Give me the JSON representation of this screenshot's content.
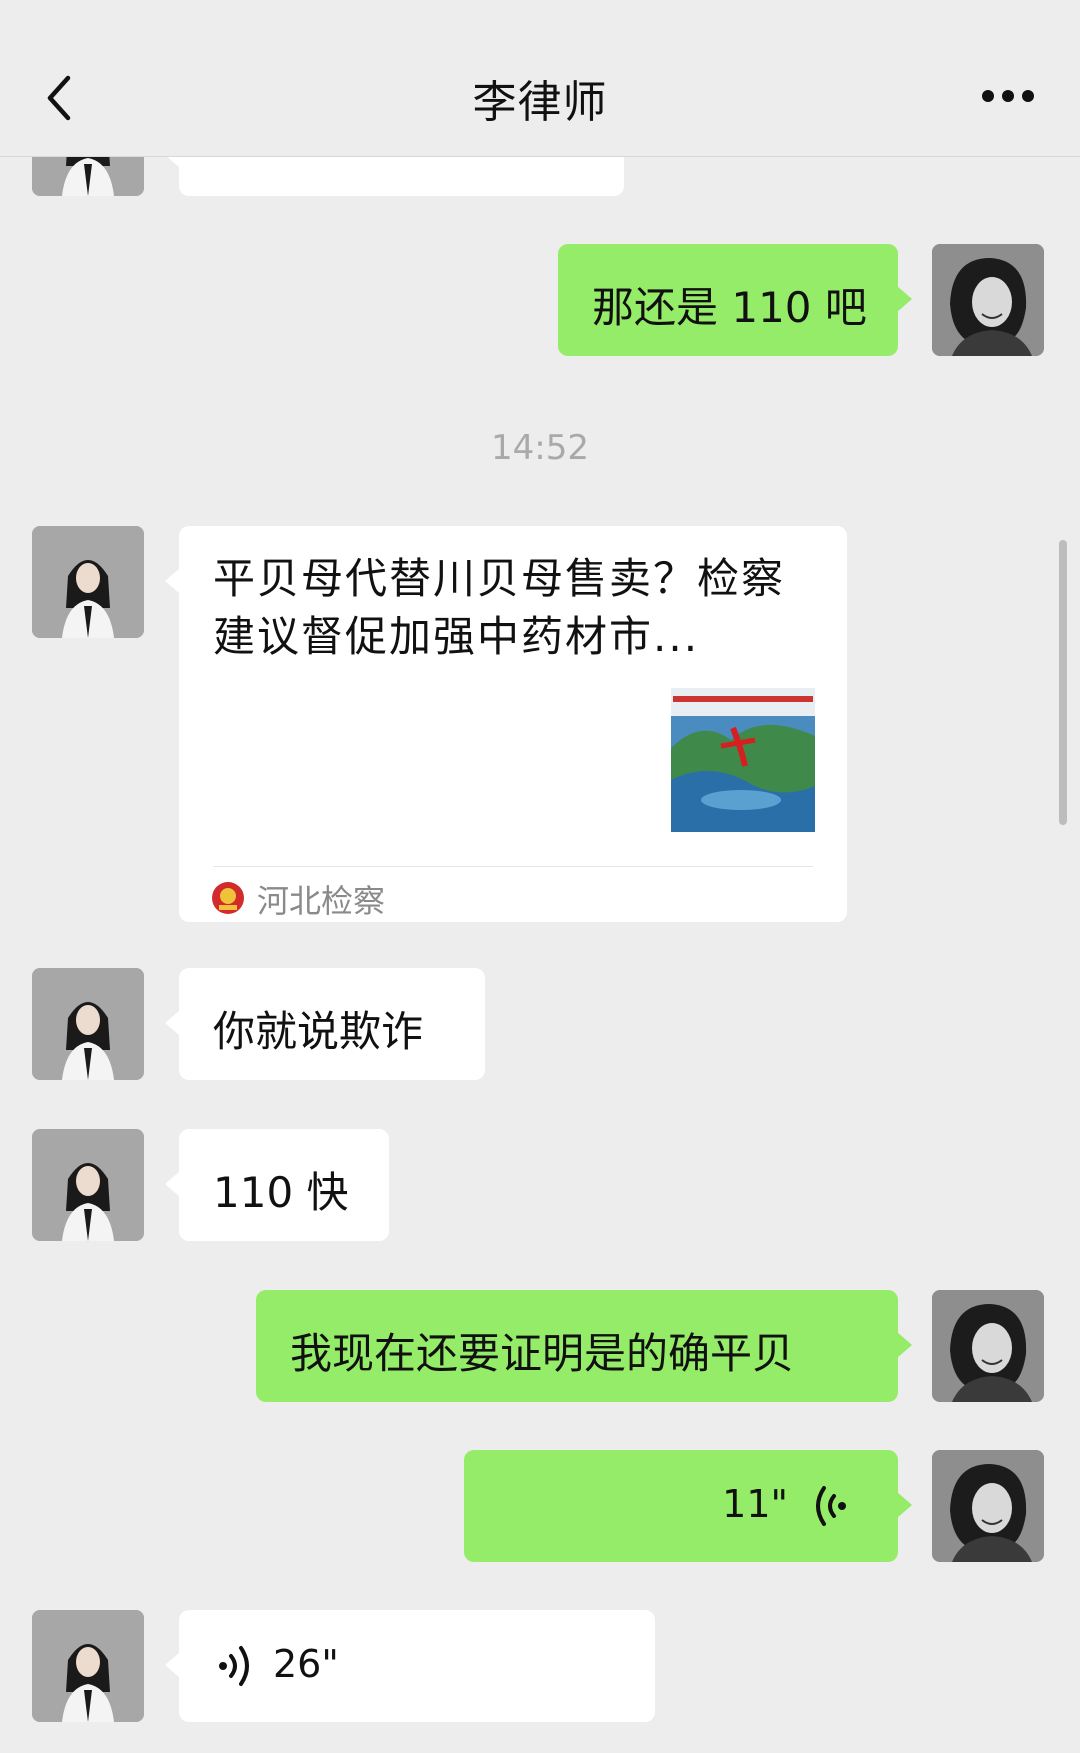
{
  "header": {
    "title": "李律师"
  },
  "timestamp": "14:52",
  "messages": [
    {
      "side": "right",
      "type": "text",
      "text": "那还是 110 吧"
    },
    {
      "side": "left",
      "type": "link_card",
      "title": "平贝母代替川贝母售卖？检察建议督促加强中药材市...",
      "source": "河北检察"
    },
    {
      "side": "left",
      "type": "text",
      "text": "你就说欺诈"
    },
    {
      "side": "left",
      "type": "text",
      "text": "110 快"
    },
    {
      "side": "right",
      "type": "text",
      "text": "我现在还要证明是的确平贝"
    },
    {
      "side": "right",
      "type": "voice",
      "duration": "11\""
    },
    {
      "side": "left",
      "type": "voice",
      "duration": "26\""
    }
  ],
  "colors": {
    "background": "#ededed",
    "bubble_sent": "#95ec69",
    "bubble_received": "#ffffff"
  },
  "icons": [
    "back-arrow-icon",
    "more-dots-icon",
    "voice-wave-icon",
    "procuratorate-emblem-icon"
  ]
}
